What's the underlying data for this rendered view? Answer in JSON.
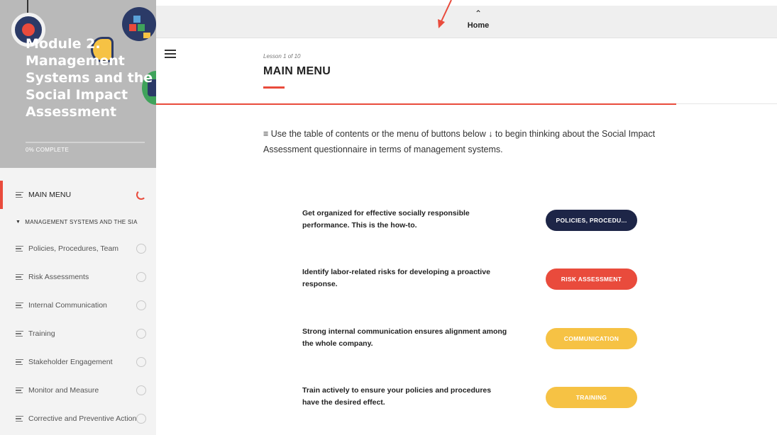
{
  "sidebar": {
    "module_title": "Module 2. Management Systems and the Social Impact Assessment",
    "progress_label": "0% COMPLETE",
    "toc": {
      "main_menu": "MAIN MENU",
      "section_label": "MANAGEMENT SYSTEMS AND THE SIA",
      "items": [
        "Policies, Procedures, Team",
        "Risk Assessments",
        "Internal Communication",
        "Training",
        "Stakeholder Engagement",
        "Monitor and Measure",
        "Corrective and Preventive Action"
      ]
    }
  },
  "topbar": {
    "home_label": "Home",
    "home_icon": "chevron-up-icon"
  },
  "lesson": {
    "counter": "Lesson 1 of 10",
    "title": "MAIN MENU",
    "intro": "≡ Use the table of contents or the menu of buttons below ↓ to begin thinking about the Social Impact Assessment questionnaire in terms of management systems."
  },
  "menu_rows": [
    {
      "text": "Get organized for effective socially responsible performance. This is the how-to.",
      "button": "POLICIES, PROCEDU...",
      "color": "#1d2547"
    },
    {
      "text": "Identify labor-related risks for developing a proactive response.",
      "button": "RISK ASSESSMENT",
      "color": "#e94b3c"
    },
    {
      "text": "Strong internal communication ensures alignment among the whole company.",
      "button": "COMMUNICATION",
      "color": "#f6c244"
    },
    {
      "text": "Train actively to ensure your policies and procedures have the desired effect.",
      "button": "TRAINING",
      "color": "#f6c244"
    }
  ],
  "colors": {
    "accent": "#e94b3c",
    "navy": "#1d2547",
    "yellow": "#f6c244"
  }
}
